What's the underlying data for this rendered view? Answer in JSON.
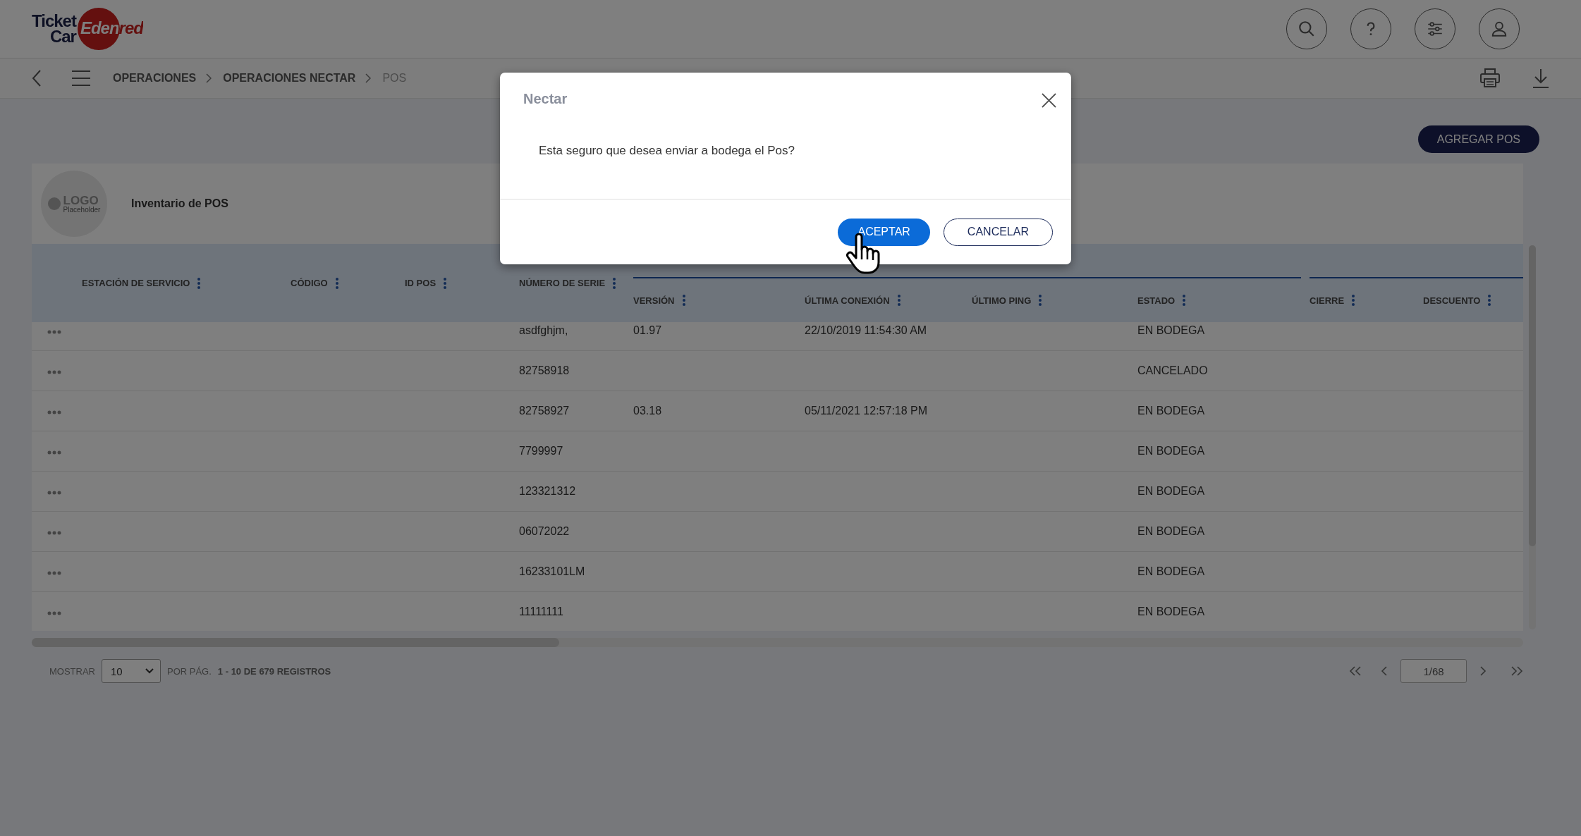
{
  "header": {
    "logo": {
      "line_1": "Ticket",
      "line_2": "Car",
      "brand": "Edenred"
    }
  },
  "breadcrumbs": [
    {
      "label": "OPERACIONES",
      "current": false
    },
    {
      "label": "OPERACIONES NECTAR",
      "current": false
    },
    {
      "label": "POS",
      "current": true
    }
  ],
  "add_button": "AGREGAR POS",
  "card": {
    "logo_placeholder": {
      "text": "LOGO",
      "subtext": "Placeholder"
    },
    "title": "Inventario de POS"
  },
  "table": {
    "columns": [
      {
        "label": "ESTACIÓN DE SERVICIO"
      },
      {
        "label": "CÓDIGO"
      },
      {
        "label": "ID POS"
      },
      {
        "label": "NÚMERO DE SERIE"
      }
    ],
    "column_groups": [
      {
        "columns": [
          {
            "label": "VERSIÓN"
          },
          {
            "label": "ÚLTIMA CONEXIÓN"
          },
          {
            "label": "ÚLTIMO PING"
          },
          {
            "label": "ESTADO"
          }
        ]
      },
      {
        "columns": [
          {
            "label": "CIERRE"
          },
          {
            "label": "DESCUENTO"
          }
        ]
      }
    ],
    "rows": [
      {
        "numero_de_serie": "asdfghjm,",
        "version": "01.97",
        "ultima_conexion": "22/10/2019 11:54:30 AM",
        "estado": "EN BODEGA"
      },
      {
        "numero_de_serie": "82758918",
        "estado": "CANCELADO"
      },
      {
        "numero_de_serie": "82758927",
        "version": "03.18",
        "ultima_conexion": "05/11/2021 12:57:18 PM",
        "estado": "EN BODEGA"
      },
      {
        "numero_de_serie": "7799997",
        "estado": "EN BODEGA"
      },
      {
        "numero_de_serie": "123321312",
        "estado": "EN BODEGA"
      },
      {
        "numero_de_serie": "06072022",
        "estado": "EN BODEGA"
      },
      {
        "numero_de_serie": "16233101LM",
        "estado": "EN BODEGA"
      },
      {
        "numero_de_serie": "11111111",
        "estado": "EN BODEGA"
      }
    ]
  },
  "footer": {
    "show_label": "MOSTRAR",
    "page_size": "10",
    "per_page_label": "POR PÁG.",
    "records": "1 - 10 DE 679 REGISTROS",
    "page": "1/68"
  },
  "modal": {
    "title": "Nectar",
    "message": "Esta seguro que desea enviar a bodega el Pos?",
    "buttons": [
      {
        "label": "ACEPTAR",
        "kind": "primary"
      },
      {
        "label": "CANCELAR",
        "kind": "secondary"
      }
    ]
  }
}
